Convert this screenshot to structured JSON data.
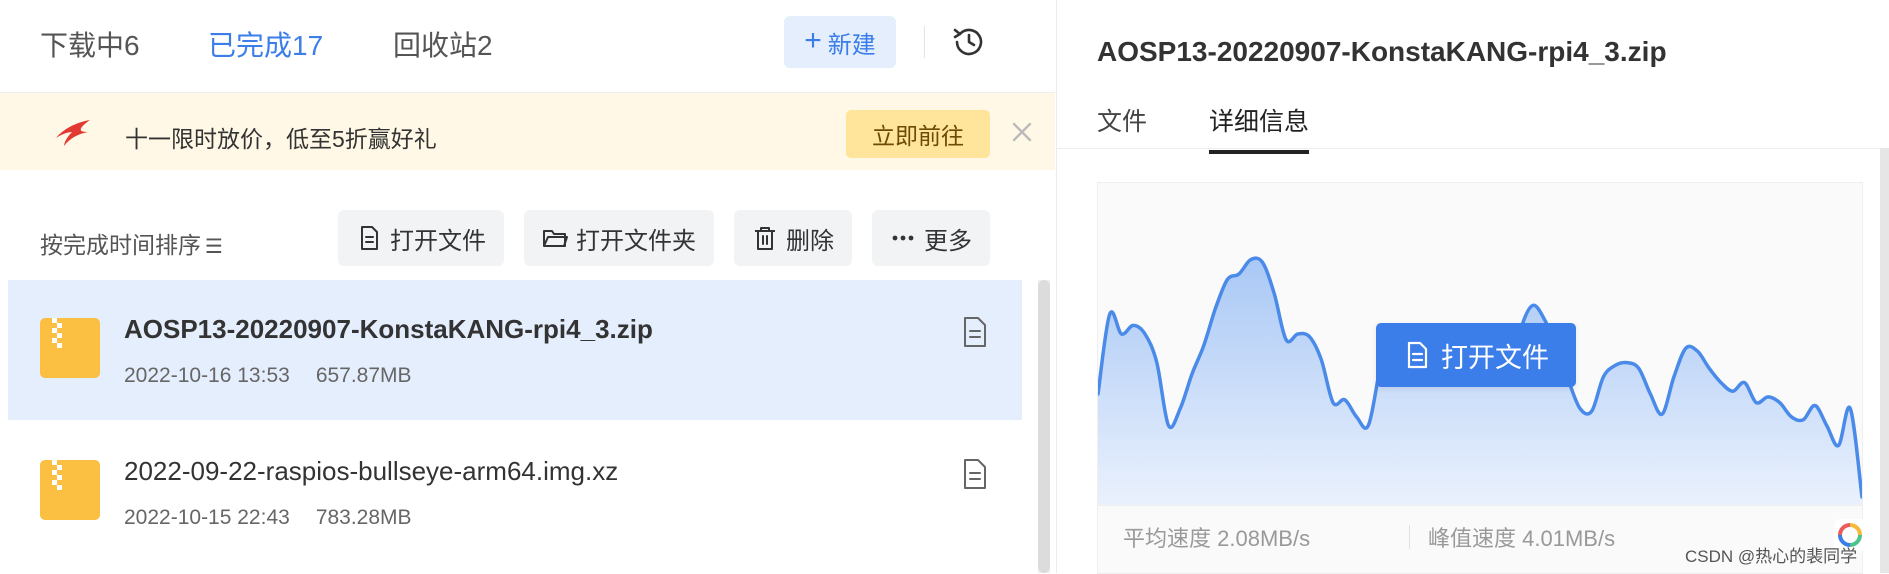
{
  "tabs": [
    {
      "label": "下载中",
      "count": "6"
    },
    {
      "label": "已完成",
      "count": "17"
    },
    {
      "label": "回收站",
      "count": "2"
    }
  ],
  "new_button": {
    "label": "新建"
  },
  "promo": {
    "text": "十一限时放价，低至5折赢好礼",
    "button": "立即前往"
  },
  "toolbar": {
    "sort_label": "按完成时间排序",
    "open_file": "打开文件",
    "open_folder": "打开文件夹",
    "delete": "删除",
    "more": "更多"
  },
  "files": [
    {
      "name": "AOSP13-20220907-KonstaKANG-rpi4_3.zip",
      "date": "2022-10-16 13:53",
      "size": "657.87MB",
      "selected": true
    },
    {
      "name": "2022-09-22-raspios-bullseye-arm64.img.xz",
      "date": "2022-10-15 22:43",
      "size": "783.28MB",
      "selected": false
    }
  ],
  "detail": {
    "title": "AOSP13-20220907-KonstaKANG-rpi4_3.zip",
    "tabs": [
      "文件",
      "详细信息"
    ],
    "active_tab": 1,
    "open_file_label": "打开文件",
    "avg_speed_label": "平均速度",
    "avg_speed": "2.08MB/s",
    "peak_speed_label": "峰值速度",
    "peak_speed": "4.01MB/s"
  },
  "chart_data": {
    "type": "area",
    "values": [
      0.36,
      0.64,
      0.57,
      0.6,
      0.57,
      0.47,
      0.25,
      0.31,
      0.43,
      0.53,
      0.66,
      0.76,
      0.78,
      0.83,
      0.82,
      0.71,
      0.55,
      0.57,
      0.56,
      0.48,
      0.33,
      0.34,
      0.28,
      0.25,
      0.45,
      0.6,
      0.53,
      0.44,
      0.4,
      0.48,
      0.45,
      0.43,
      0.44,
      0.41,
      0.42,
      0.4,
      0.59,
      0.67,
      0.62,
      0.52,
      0.41,
      0.31,
      0.3,
      0.42,
      0.46,
      0.47,
      0.45,
      0.36,
      0.29,
      0.42,
      0.52,
      0.51,
      0.45,
      0.4,
      0.37,
      0.4,
      0.33,
      0.35,
      0.33,
      0.28,
      0.27,
      0.32,
      0.25,
      0.18,
      0.31,
      0.0
    ],
    "ylim": [
      0,
      1
    ],
    "grid": false,
    "color": "#4a8ae8"
  },
  "watermark": "CSDN @热心的裴同学",
  "colors": {
    "accent": "#3b7de9",
    "selected_row": "#e5eefd",
    "promo_bg": "#fff8e6",
    "promo_button": "#ffe49b",
    "file_icon": "#fbbf42"
  }
}
